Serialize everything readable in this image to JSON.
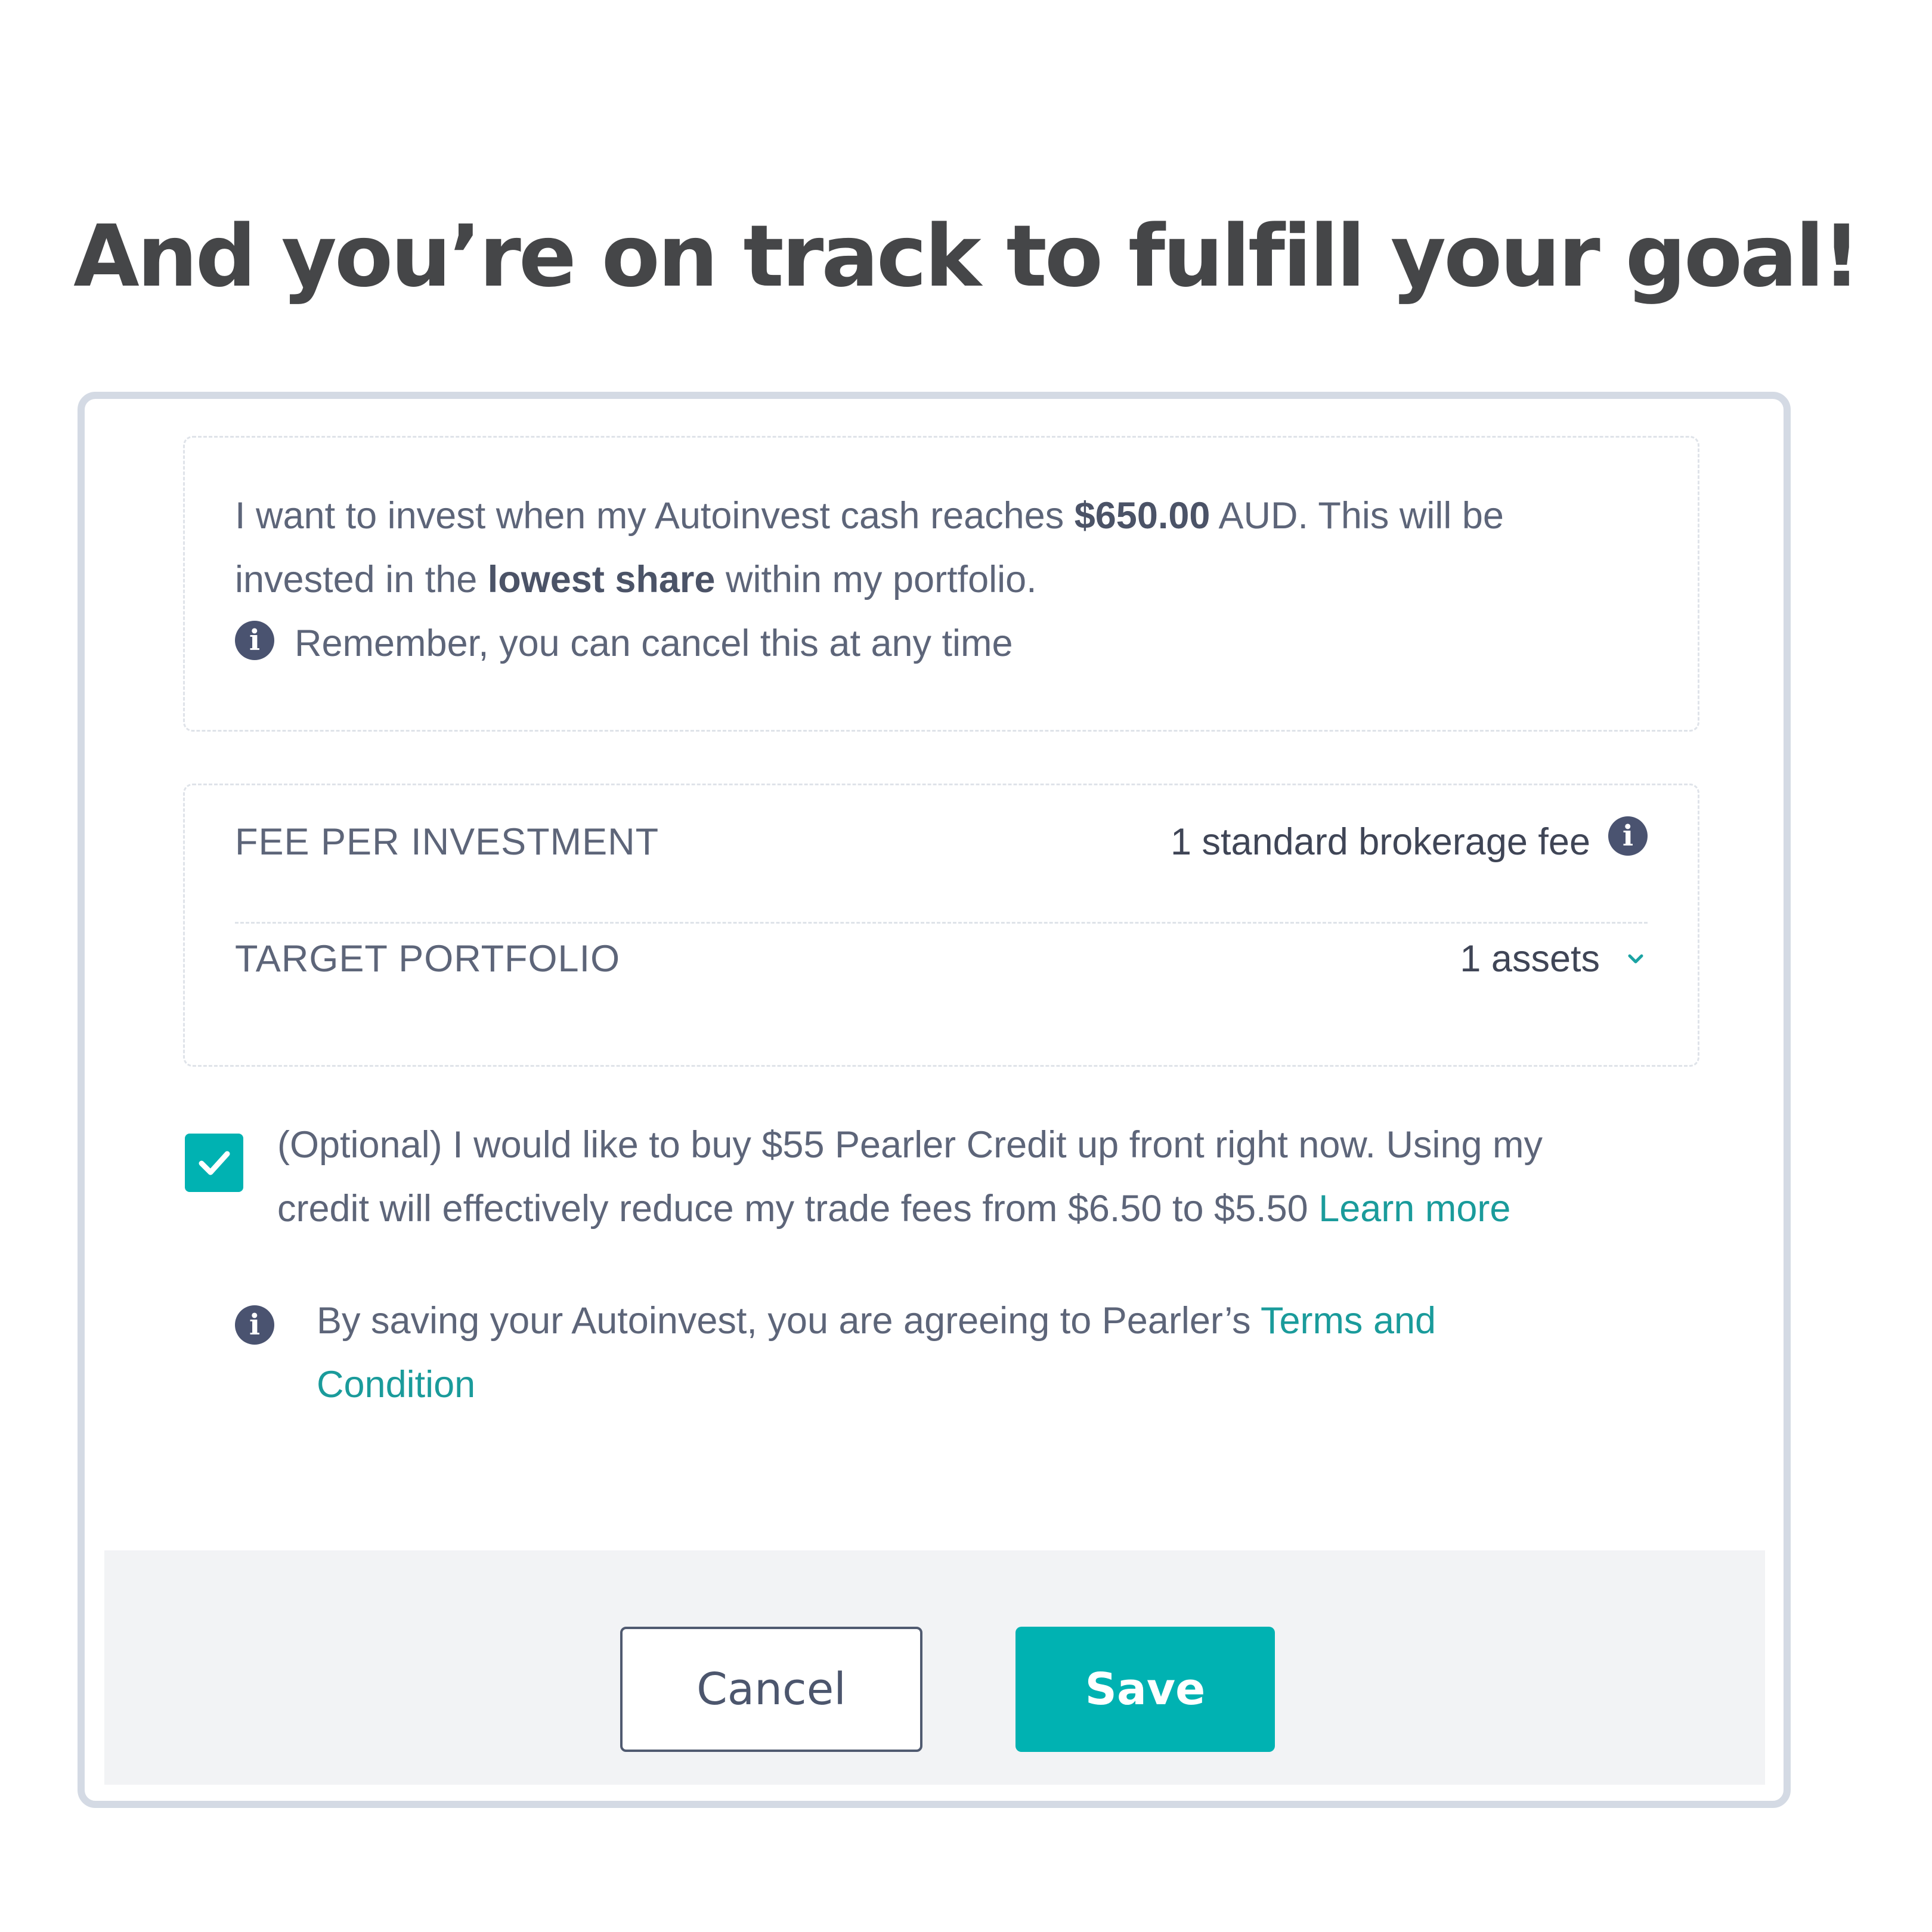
{
  "headline": "And you’re on track to fulfill your goal!",
  "summary": {
    "line1_pre": "I want to invest when my Autoinvest cash reaches ",
    "amount": "$650.00",
    "line1_post": " AUD. This will be",
    "line2_pre": "invested in the ",
    "strategy": "lowest share",
    "line2_post": " within my portfolio.",
    "reminder": "Remember, you can cancel this at any time"
  },
  "details": {
    "fee_label": "FEE PER INVESTMENT",
    "fee_value": "1 standard brokerage fee",
    "portfolio_label": "TARGET PORTFOLIO",
    "portfolio_value": "1 assets"
  },
  "credit_option": {
    "checked": true,
    "line1": "(Optional) I would like to buy $55 Pearler Credit up front right now. Using my",
    "line2": "credit will effectively reduce my trade fees from $6.50 to $5.50 ",
    "learn_more": "Learn more"
  },
  "terms": {
    "text": "By saving your Autoinvest, you are agreeing to Pearler’s ",
    "link_line1": "Terms and",
    "link_line2": "Condition"
  },
  "buttons": {
    "cancel": "Cancel",
    "save": "Save"
  },
  "colors": {
    "accent": "#00b2b2",
    "link": "#1a9b9b",
    "icon": "#4a5370"
  },
  "icons": {
    "info": "info-icon",
    "chevron": "chevron-down-icon",
    "check": "check-icon"
  }
}
